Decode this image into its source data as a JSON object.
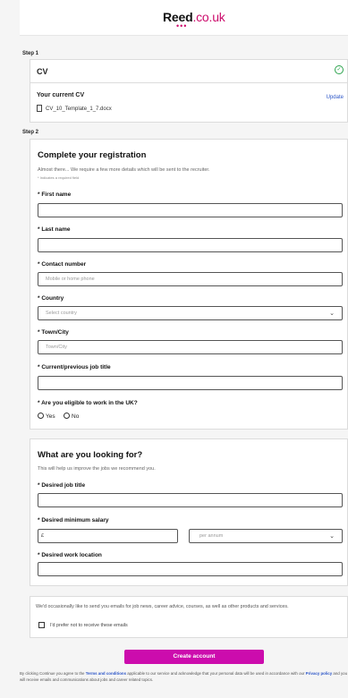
{
  "header": {
    "logo_main": "Reed",
    "logo_suffix": ".co.uk",
    "logo_dots": "•••"
  },
  "step1": {
    "label": "Step 1",
    "cv_title": "CV",
    "current_cv_label": "Your current CV",
    "file_name": "CV_10_Template_1_7.docx",
    "update_label": "Update"
  },
  "step2": {
    "label": "Step 2",
    "title": "Complete your registration",
    "subtitle": "Almost there... We require a few more details which will be sent to the recruiter.",
    "required_note": "* Indicates a required field",
    "fields": {
      "first_name": {
        "label": "* First name",
        "placeholder": ""
      },
      "last_name": {
        "label": "* Last name",
        "placeholder": ""
      },
      "contact_number": {
        "label": "* Contact number",
        "placeholder": "Mobile or home phone"
      },
      "country": {
        "label": "* Country",
        "placeholder": "Select country"
      },
      "town_city": {
        "label": "* Town/City",
        "placeholder": "Town/City"
      },
      "job_title": {
        "label": "* Current/previous job title",
        "placeholder": ""
      }
    },
    "eligibility": {
      "label": "* Are you eligible to work in the UK?",
      "yes": "Yes",
      "no": "No"
    }
  },
  "looking_for": {
    "title": "What are you looking for?",
    "subtitle": "This will help us improve the jobs we recommend you.",
    "desired_job_title": {
      "label": "* Desired job title"
    },
    "desired_salary": {
      "label": "* Desired minimum salary",
      "currency": "£",
      "period": "per annum"
    },
    "desired_location": {
      "label": "* Desired work location"
    }
  },
  "consent": {
    "text": "We'd occasionally like to send you emails for job news, career advice, courses, as well as other products and services.",
    "checkbox_label": "I'd prefer not to receive these emails"
  },
  "create_button": "Create account",
  "legal": {
    "pre": "By clicking Continue you agree to the ",
    "terms": "Terms and conditions",
    "mid": " applicable to our service and acknowledge that your personal data will be used in accordance with our ",
    "privacy": "Privacy policy",
    "post": " and you will receive emails and communications about jobs and career related topics."
  },
  "colors": {
    "brand": "#cc0cad",
    "link": "#2e57c8",
    "success": "#2ea44f"
  }
}
